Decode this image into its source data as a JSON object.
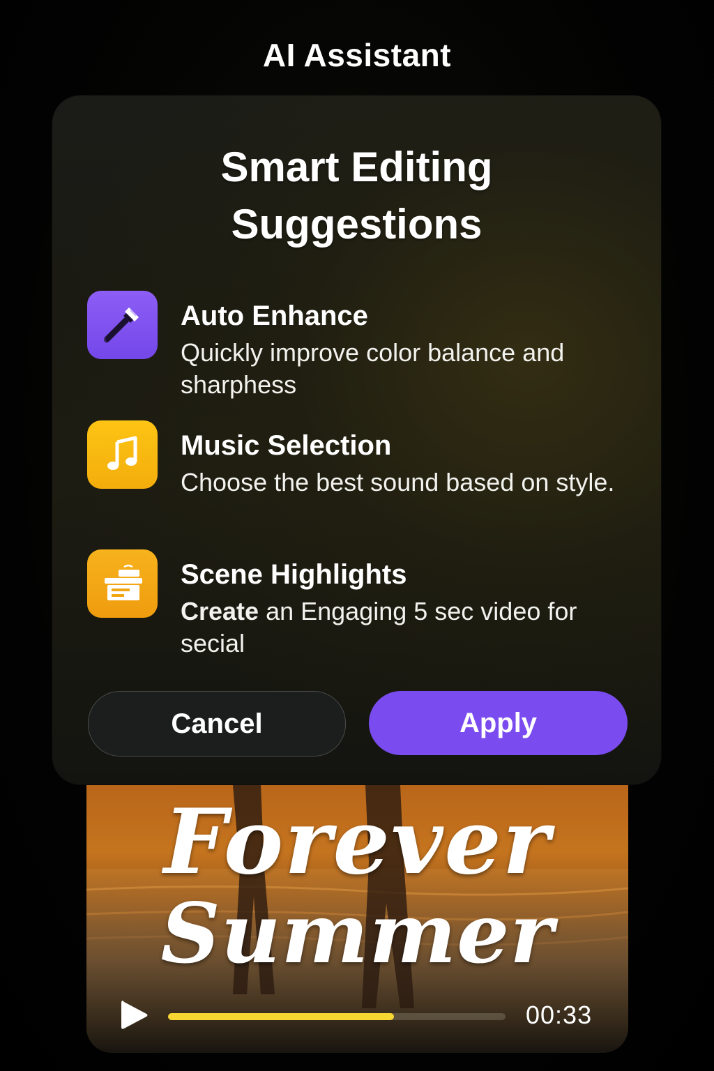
{
  "header": {
    "title": "AI Assistant"
  },
  "card": {
    "title_line1": "Smart Editing",
    "title_line2": "Suggestions",
    "items": [
      {
        "icon": "paintbrush-icon",
        "title": "Auto Enhance",
        "description": "Quickly improve color balance and sharphess"
      },
      {
        "icon": "music-note-icon",
        "title": "Music Selection",
        "description": "Choose the best sound based on style."
      },
      {
        "icon": "scene-highlights-icon",
        "title": "Scene Highlights",
        "description_bold": "Create",
        "description_rest": " an Engaging 5 sec video for secial"
      }
    ],
    "cancel_label": "Cancel",
    "apply_label": "Apply"
  },
  "video": {
    "title_line1": "Forever",
    "title_line2": "Summer",
    "time": "00:33",
    "progress": 0.67
  },
  "colors": {
    "accent": "#7a4cf0",
    "progress": "#f7d732",
    "icon_purple": "#8d5ef5",
    "icon_yellow": "#fcc414",
    "icon_amber": "#f7b21c"
  }
}
